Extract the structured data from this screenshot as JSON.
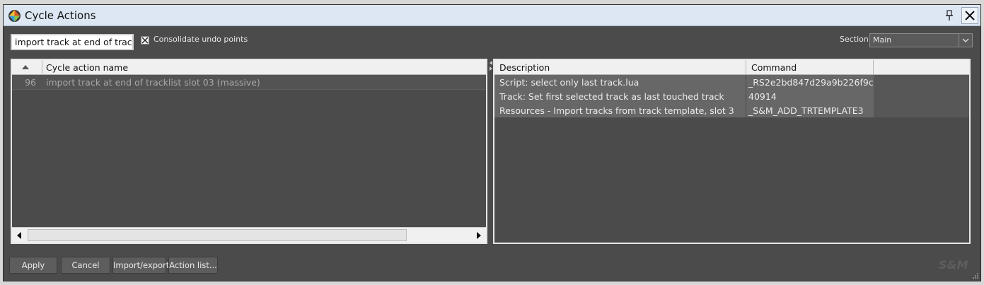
{
  "window": {
    "title": "Cycle Actions",
    "icon": "reaper-app-icon",
    "pin_icon": "pin-icon",
    "close_icon": "close-icon"
  },
  "toolbar": {
    "filter_value": "import track at end of tracklist",
    "consolidate_checked": true,
    "consolidate_label": "Consolidate undo points",
    "section_label": "Section:",
    "section_value": "Main"
  },
  "left_table": {
    "sort_icon": "sort-ascending-icon",
    "name_header": "Cycle action name",
    "rows": [
      {
        "id": "96",
        "name": "import track at end of tracklist slot 03 (massive)"
      }
    ]
  },
  "right_table": {
    "headers": {
      "description": "Description",
      "command": "Command"
    },
    "rows": [
      {
        "description": "Script: select only last track.lua",
        "command": "_RS2e2bd847d29a9b226f9c..."
      },
      {
        "description": "Track: Set first selected track as last touched track",
        "command": "40914"
      },
      {
        "description": "Resources - Import tracks from track template, slot 3",
        "command": "_S&M_ADD_TRTEMPLATE3"
      }
    ]
  },
  "buttons": {
    "apply": "Apply",
    "cancel": "Cancel",
    "import_export": "Import/export",
    "action_list": "Action list..."
  },
  "branding": "S&M",
  "colors": {
    "panel_bg": "#4b4b4b",
    "titlebar_bg": "#dde7f4",
    "row_bg": "#676767"
  }
}
